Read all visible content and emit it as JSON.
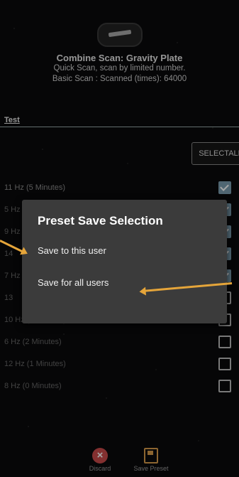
{
  "header": {
    "title": "Combine Scan: Gravity Plate",
    "subtitle1": "Quick Scan, scan by limited number.",
    "subtitle2": "Basic Scan : Scanned (times): 64000"
  },
  "preset_name": "Test",
  "select_all_label": "SELECTALL",
  "list_items": [
    {
      "label": "11 Hz (5 Minutes)",
      "checked": true
    },
    {
      "label": "5 Hz",
      "checked": true
    },
    {
      "label": "9 Hz",
      "checked": true
    },
    {
      "label": "14",
      "checked": true
    },
    {
      "label": "7 Hz",
      "checked": true
    },
    {
      "label": "13",
      "checked": false
    },
    {
      "label": "10 Hz (6 Minutes)",
      "checked": false
    },
    {
      "label": "6 Hz (2 Minutes)",
      "checked": false
    },
    {
      "label": "12 Hz (1 Minutes)",
      "checked": false
    },
    {
      "label": "8 Hz (0 Minutes)",
      "checked": false
    }
  ],
  "dialog": {
    "title": "Preset Save Selection",
    "option1": "Save to this user",
    "option2": "Save for all users"
  },
  "footer": {
    "discard_label": "Discard",
    "save_label": "Save Preset"
  },
  "colors": {
    "accent": "#e5a53a",
    "checkbox": "#7c9db0",
    "dialog_bg": "#3b3b3b"
  }
}
